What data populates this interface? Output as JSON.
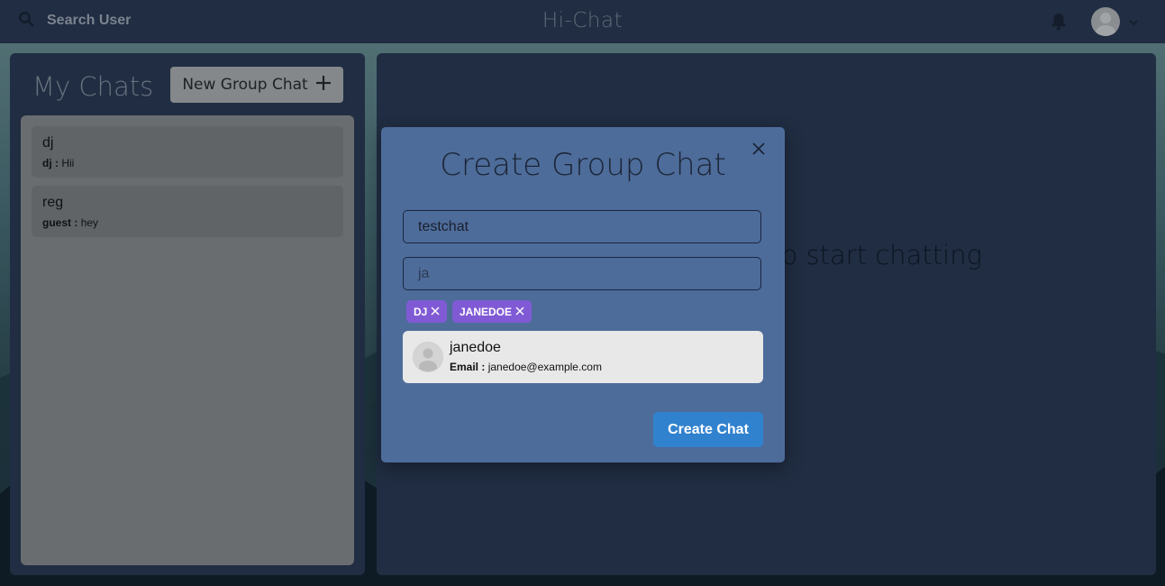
{
  "header": {
    "search_label": "Search User",
    "app_title": "Hi-Chat",
    "icons": {
      "search": "search-icon",
      "bell": "bell-icon",
      "avatar": "avatar",
      "chevron": "chevron-down-icon"
    }
  },
  "sidebar": {
    "title": "My Chats",
    "new_group_label": "New Group Chat",
    "chats": [
      {
        "name": "dj",
        "sender": "dj :",
        "message": "Hii"
      },
      {
        "name": "reg",
        "sender": "guest :",
        "message": "hey"
      }
    ]
  },
  "main": {
    "placeholder": "o start chatting"
  },
  "modal": {
    "title": "Create Group Chat",
    "chat_name_value": "testchat",
    "search_value": "ja",
    "selected_users": [
      {
        "label": "DJ"
      },
      {
        "label": "JANEDOE"
      }
    ],
    "result": {
      "name": "janedoe",
      "email_label": "Email :",
      "email": "janedoe@example.com"
    },
    "create_label": "Create Chat"
  },
  "colors": {
    "topbar": "#2c3b57",
    "panel": "#2c3b57",
    "modal": "#4d6c9a",
    "tag": "#805ad5",
    "primary_button": "#3182ce"
  }
}
